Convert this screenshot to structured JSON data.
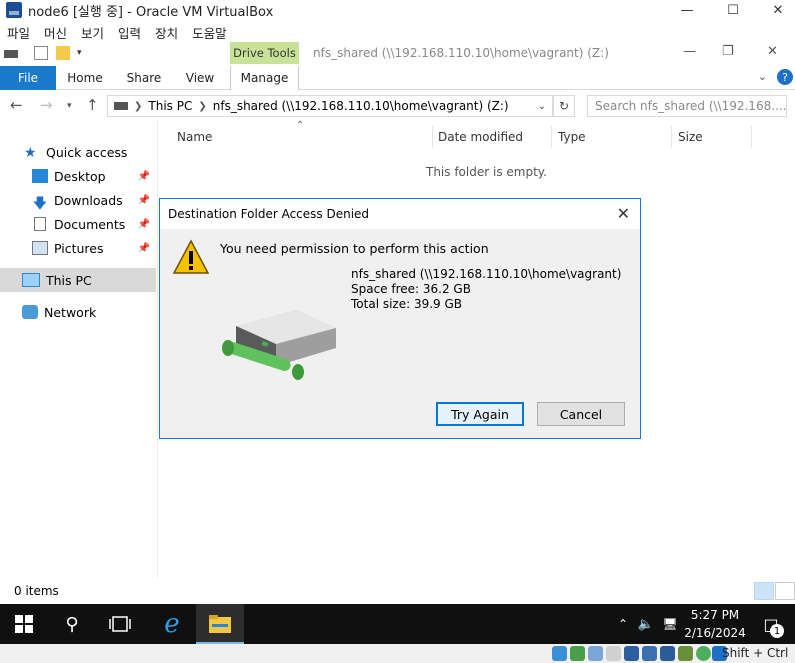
{
  "vm_window": {
    "title": "node6 [실행 중] - Oracle VM VirtualBox",
    "menu": [
      "파일",
      "머신",
      "보기",
      "입력",
      "장치",
      "도움말"
    ]
  },
  "explorer": {
    "context_tab": "Drive Tools",
    "window_path": "nfs_shared (\\\\192.168.110.10\\home\\vagrant) (Z:)",
    "ribbon_tabs": [
      "File",
      "Home",
      "Share",
      "View",
      "Manage"
    ],
    "address": {
      "segments": [
        "This PC",
        "nfs_shared (\\\\192.168.110.10\\home\\vagrant) (Z:)"
      ]
    },
    "search_placeholder": "Search nfs_shared (\\\\192.168....",
    "sidebar": {
      "quick_access": "Quick access",
      "items": [
        "Desktop",
        "Downloads",
        "Documents",
        "Pictures"
      ],
      "this_pc": "This PC",
      "network": "Network"
    },
    "columns": [
      "Name",
      "Date modified",
      "Type",
      "Size"
    ],
    "empty_message": "This folder is empty.",
    "status": "0 items"
  },
  "dialog": {
    "title": "Destination Folder Access Denied",
    "message": "You need permission to perform this action",
    "drive_name": "nfs_shared (\\\\192.168.110.10\\home\\vagrant)",
    "space_free": "Space free: 36.2 GB",
    "total_size": "Total size: 39.9 GB",
    "try_again": "Try Again",
    "cancel": "Cancel"
  },
  "taskbar": {
    "time": "5:27 PM",
    "date": "2/16/2024",
    "notification_count": "1"
  },
  "vbox_status": {
    "host_key": "Shift + Ctrl"
  },
  "colors": {
    "accent": "#1979ca",
    "drive_tools": "#c9e29a",
    "warning": "#f6c200"
  }
}
